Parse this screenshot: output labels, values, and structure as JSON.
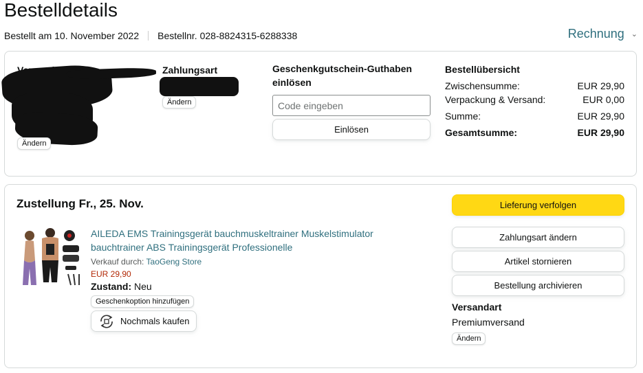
{
  "page": {
    "title": "Bestelldetails",
    "ordered_on": "Bestellt am 10. November 2022",
    "order_number": "Bestellnr. 028-8824315-6288338",
    "invoice_label": "Rechnung"
  },
  "order_info": {
    "address_label": "Versandadresse",
    "address_change": "Ändern",
    "payment_label": "Zahlungsart",
    "payment_change": "Ändern",
    "gift_label": "Geschenkgutschein-Guthaben einlösen",
    "gift_placeholder": "Code eingeben",
    "gift_redeem": "Einlösen",
    "summary_label": "Bestellübersicht",
    "summary_rows": [
      {
        "label": "Zwischensumme:",
        "value": "EUR 29,90"
      },
      {
        "label": "Verpackung & Versand:",
        "value": "EUR 0,00"
      },
      {
        "label": "Summe:",
        "value": "EUR 29,90"
      },
      {
        "label": "Gesamtsumme:",
        "value": "EUR 29,90"
      }
    ]
  },
  "shipment": {
    "delivery_heading": "Zustellung Fr., 25. Nov.",
    "product_name": "AILEDA EMS Trainingsgerät bauchmuskeltrainer Muskelstimulator bauchtrainer ABS Trainingsgerät Professionelle",
    "seller_prefix": "Verkauf durch:",
    "seller_name": "TaoGeng Store",
    "price": "EUR 29,90",
    "condition_label": "Zustand:",
    "condition_value": "Neu",
    "gift_option": "Geschenkoption hinzufügen",
    "buy_again": "Nochmals kaufen",
    "actions": {
      "track": "Lieferung verfolgen",
      "change_payment": "Zahlungsart ändern",
      "cancel": "Artikel stornieren",
      "archive": "Bestellung archivieren"
    },
    "shipping_method_label": "Versandart",
    "shipping_method_value": "Premiumversand",
    "shipping_change": "Ändern"
  },
  "colors": {
    "link": "#2f6f7e",
    "primary_button": "#ffd814",
    "price": "#b12704"
  }
}
